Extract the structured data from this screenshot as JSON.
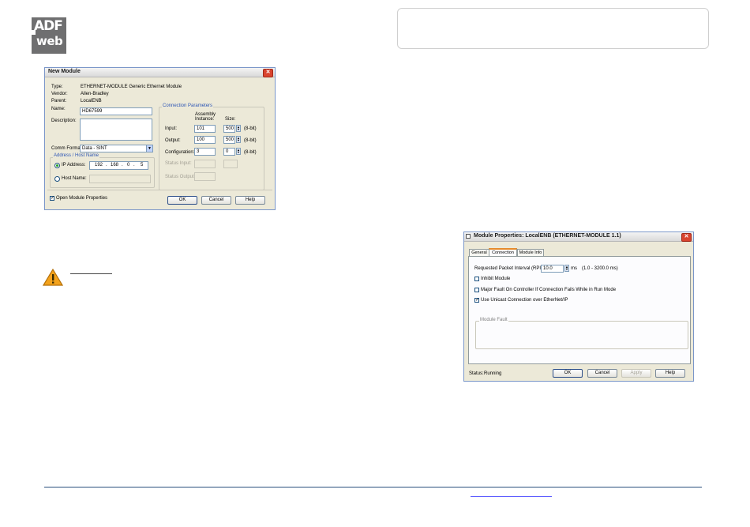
{
  "logo": {
    "line1": "ADF",
    "line2": "web"
  },
  "new_module": {
    "title": "New Module",
    "type_label": "Type:",
    "type_value": "ETHERNET-MODULE Generic Ethernet Module",
    "vendor_label": "Vendor:",
    "vendor_value": "Allen-Bradley",
    "parent_label": "Parent:",
    "parent_value": "LocalENB",
    "name_label": "Name:",
    "name_value": "HD67599",
    "description_label": "Description:",
    "description_value": "",
    "comm_format_label": "Comm Format:",
    "comm_format_value": "Data - SINT",
    "address_group_title": "Address / Host Name",
    "ip_label": "IP Address:",
    "ip_octets": [
      "192",
      "168",
      "0",
      "5"
    ],
    "host_label": "Host Name:",
    "host_value": "",
    "conn_group_title": "Connection Parameters",
    "col_assembly": "Assembly",
    "col_instance": "Instance:",
    "col_size": "Size:",
    "input_label": "Input:",
    "input_instance": "101",
    "input_size": "500",
    "output_label": "Output:",
    "output_instance": "100",
    "output_size": "500",
    "config_label": "Configuration:",
    "config_instance": "3",
    "config_size": "0",
    "unit_8bit": "(8-bit)",
    "status_input_label": "Status Input:",
    "status_output_label": "Status Output:",
    "open_props_label": "Open Module Properties",
    "open_props_checked": true,
    "ok": "OK",
    "cancel": "Cancel",
    "help": "Help"
  },
  "module_props": {
    "title": "Module Properties: LocalENB (ETHERNET-MODULE 1.1)",
    "tabs": [
      "General",
      "Connection",
      "Module Info"
    ],
    "active_tab": "Connection",
    "rpi_label": "Requested Packet Interval (RPI):",
    "rpi_value": "10.0",
    "rpi_unit": "ms",
    "rpi_range": "(1.0 - 3200.0 ms)",
    "inhibit_label": "Inhibit Module",
    "major_fault_label": "Major Fault On Controller If Connection Fails While in Run Mode",
    "unicast_label": "Use Unicast Connection over EtherNet/IP",
    "module_fault_title": "Module Fault",
    "status_label": "Status:",
    "status_value": "Running",
    "ok": "OK",
    "cancel": "Cancel",
    "apply": "Apply",
    "help": "Help"
  }
}
